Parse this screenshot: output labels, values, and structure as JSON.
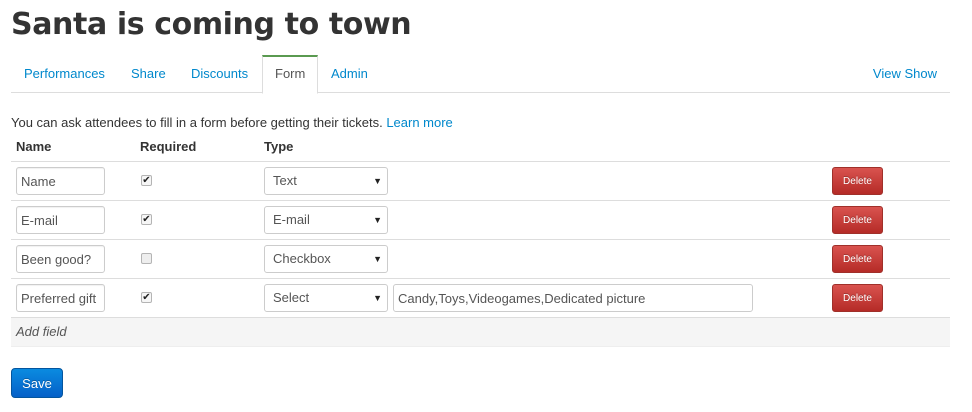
{
  "header": {
    "title": "Santa is coming to town"
  },
  "tabs": [
    {
      "label": "Performances"
    },
    {
      "label": "Share"
    },
    {
      "label": "Discounts"
    },
    {
      "label": "Form"
    },
    {
      "label": "Admin"
    }
  ],
  "active_tab": "Form",
  "view_show_label": "View Show",
  "intro": {
    "text": "You can ask attendees to fill in a form before getting their tickets.",
    "link": "Learn more"
  },
  "table": {
    "headers": {
      "name": "Name",
      "required": "Required",
      "type": "Type"
    },
    "rows": [
      {
        "name": "Name",
        "required": true,
        "type": "Text",
        "options": "",
        "delete_label": "Delete"
      },
      {
        "name": "E-mail",
        "required": true,
        "type": "E-mail",
        "options": "",
        "delete_label": "Delete"
      },
      {
        "name": "Been good?",
        "required": false,
        "type": "Checkbox",
        "options": "",
        "delete_label": "Delete"
      },
      {
        "name": "Preferred gift",
        "required": true,
        "type": "Select",
        "options": "Candy,Toys,Videogames,Dedicated picture",
        "delete_label": "Delete"
      }
    ],
    "add_field_label": "Add field"
  },
  "save_label": "Save",
  "icons": {
    "checkbox_checked": "checkmark-icon",
    "select_caret": "caret-down-icon"
  },
  "colors": {
    "link": "#0088cc",
    "danger": "#c9302c",
    "primary": "#0668cf",
    "active_tab_accent": "#5a9a50"
  }
}
